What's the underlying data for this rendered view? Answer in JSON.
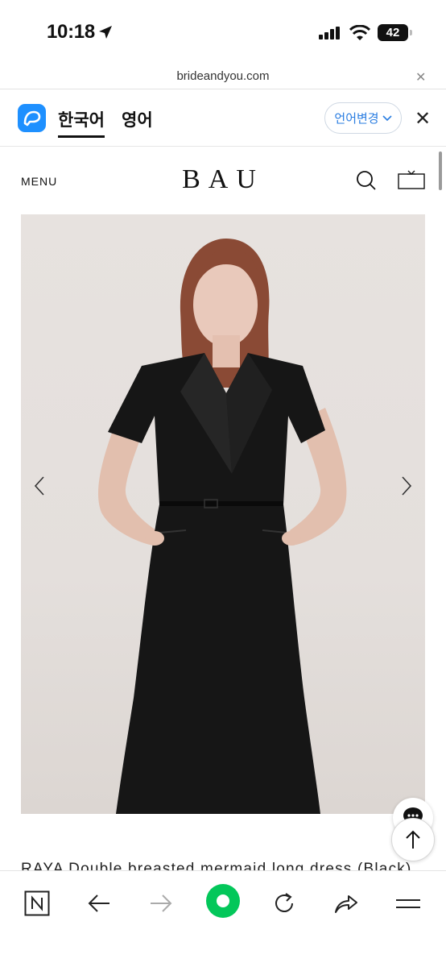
{
  "status_bar": {
    "time": "10:18",
    "battery": "42"
  },
  "url_bar": {
    "url": "brideandyou.com"
  },
  "translate_bar": {
    "tab_korean": "한국어",
    "tab_english": "영어",
    "change_language": "언어변경"
  },
  "site_header": {
    "menu_label": "MENU",
    "logo": "BAU"
  },
  "product": {
    "title": "RAYA Double breasted mermaid long dress (Black)"
  },
  "colors": {
    "papago_blue": "#1e90ff",
    "naver_green": "#03c75a",
    "link_blue": "#2a7de1"
  }
}
